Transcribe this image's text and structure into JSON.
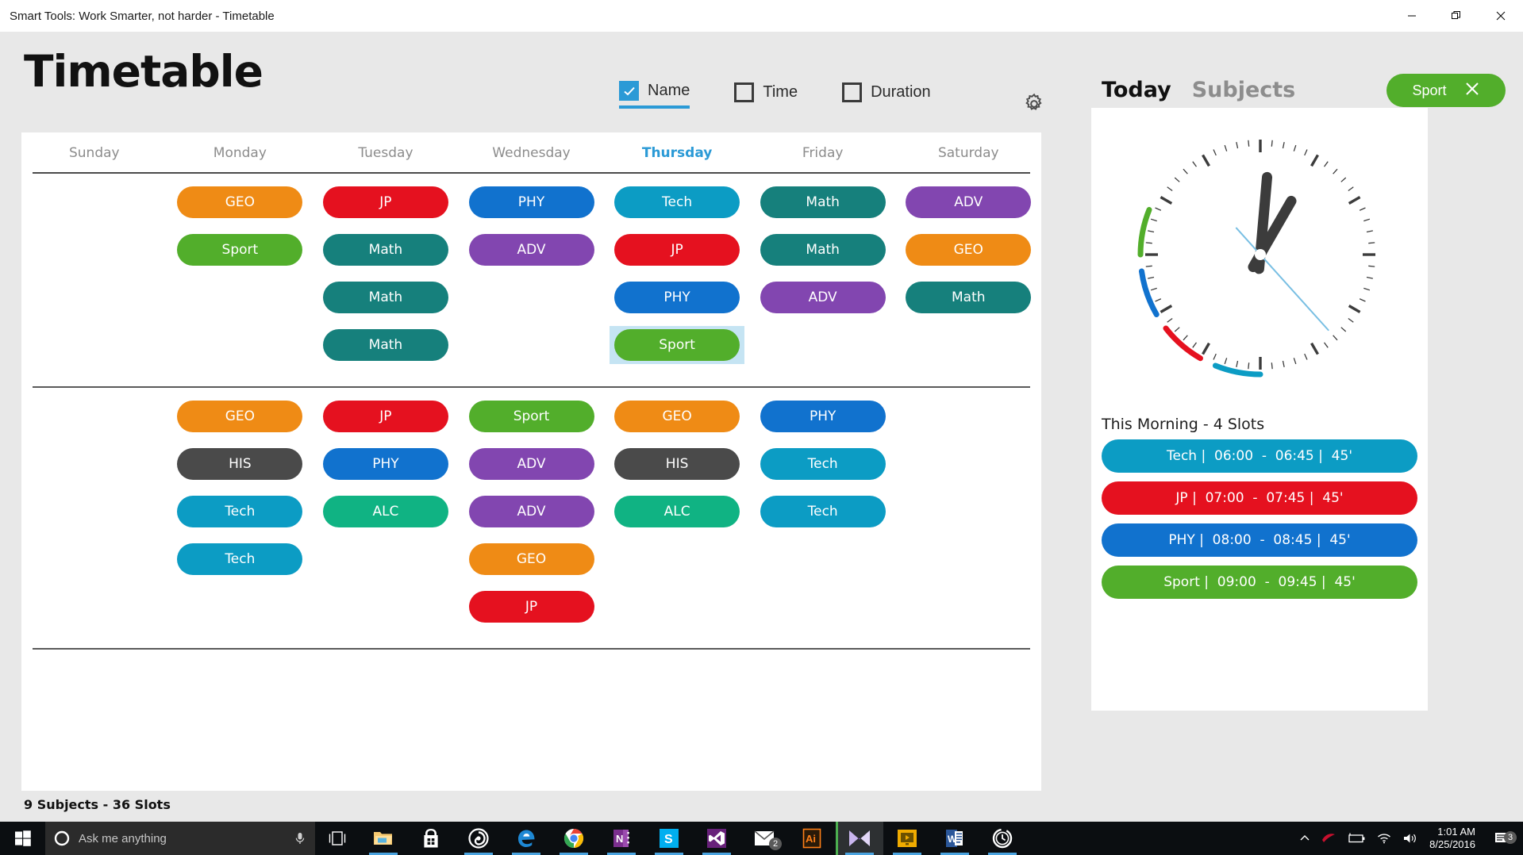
{
  "window": {
    "title": "Smart Tools: Work Smarter, not harder - Timetable",
    "minimize_label": "—",
    "maximize_label": "❐",
    "close_label": "✕"
  },
  "app": {
    "title": "Timetable",
    "footer": "9 Subjects  -  36 Slots",
    "gear_icon": "gear-icon"
  },
  "modes": [
    {
      "label": "Name",
      "checked": true
    },
    {
      "label": "Time",
      "checked": false
    },
    {
      "label": "Duration",
      "checked": false
    }
  ],
  "colors": {
    "GEO": "#ef8b15",
    "Sport": "#52ae2b",
    "JP": "#e5111f",
    "Math": "#16807c",
    "PHY": "#1172ce",
    "ADV": "#8246b0",
    "Tech": "#0c9cc4",
    "HIS": "#4a4a4a",
    "ALC": "#10b383",
    "accent": "#2b9ad6",
    "selection": "#c5e4f3"
  },
  "timetable": {
    "days": [
      {
        "name": "Sunday",
        "active": false
      },
      {
        "name": "Monday",
        "active": false
      },
      {
        "name": "Tuesday",
        "active": false
      },
      {
        "name": "Wednesday",
        "active": false
      },
      {
        "name": "Thursday",
        "active": true
      },
      {
        "name": "Friday",
        "active": false
      },
      {
        "name": "Saturday",
        "active": false
      }
    ],
    "blocks": [
      {
        "columns": [
          [],
          [
            {
              "label": "GEO"
            },
            {
              "label": "Sport"
            }
          ],
          [
            {
              "label": "JP"
            },
            {
              "label": "Math"
            },
            {
              "label": "Math"
            },
            {
              "label": "Math"
            }
          ],
          [
            {
              "label": "PHY"
            },
            {
              "label": "ADV"
            }
          ],
          [
            {
              "label": "Tech"
            },
            {
              "label": "JP"
            },
            {
              "label": "PHY"
            },
            {
              "label": "Sport",
              "selected": true
            }
          ],
          [
            {
              "label": "Math"
            },
            {
              "label": "Math"
            },
            {
              "label": "ADV"
            }
          ],
          [
            {
              "label": "ADV"
            },
            {
              "label": "GEO"
            },
            {
              "label": "Math"
            }
          ]
        ]
      },
      {
        "columns": [
          [],
          [
            {
              "label": "GEO"
            },
            {
              "label": "HIS"
            },
            {
              "label": "Tech"
            },
            {
              "label": "Tech"
            }
          ],
          [
            {
              "label": "JP"
            },
            {
              "label": "PHY"
            },
            {
              "label": "ALC"
            }
          ],
          [
            {
              "label": "Sport"
            },
            {
              "label": "ADV"
            },
            {
              "label": "ADV"
            },
            {
              "label": "GEO"
            },
            {
              "label": "JP"
            }
          ],
          [
            {
              "label": "GEO"
            },
            {
              "label": "HIS"
            },
            {
              "label": "ALC"
            }
          ],
          [
            {
              "label": "PHY"
            },
            {
              "label": "Tech"
            },
            {
              "label": "Tech"
            }
          ],
          []
        ]
      }
    ]
  },
  "sidebar": {
    "tabs": [
      {
        "label": "Today",
        "active": true
      },
      {
        "label": "Subjects",
        "active": false
      }
    ],
    "selected_subject": {
      "label": "Sport",
      "color": "#52ae2b",
      "close_icon": "close-icon"
    },
    "clock": {
      "hour_hand_deg": 5,
      "minute_hand_deg": 30,
      "second_hand_deg": 138,
      "arcs": [
        {
          "subject": "Tech",
          "color": "#0c9cc4",
          "start_deg": 180,
          "end_deg": 202
        },
        {
          "subject": "JP",
          "color": "#e5111f",
          "start_deg": 210,
          "end_deg": 232
        },
        {
          "subject": "PHY",
          "color": "#1172ce",
          "start_deg": 240,
          "end_deg": 262
        },
        {
          "subject": "Sport",
          "color": "#52ae2b",
          "start_deg": 270,
          "end_deg": 292
        }
      ]
    },
    "slots_heading": "This Morning - 4 Slots",
    "slots": [
      {
        "text": "Tech |  06:00  -  06:45 |  45'",
        "color": "#0c9cc4"
      },
      {
        "text": "JP |  07:00  -  07:45 |  45'",
        "color": "#e5111f"
      },
      {
        "text": "PHY |  08:00  -  08:45 |  45'",
        "color": "#1172ce"
      },
      {
        "text": "Sport |  09:00  -  09:45 |  45'",
        "color": "#52ae2b"
      }
    ]
  },
  "taskbar": {
    "start_icon": "windows-start-icon",
    "search_placeholder": "Ask me anything",
    "cortana_icon": "cortana-ring-icon",
    "mic_icon": "microphone-icon",
    "taskview_icon": "task-view-icon",
    "items": [
      {
        "name": "file-explorer-icon",
        "running": true,
        "active": false,
        "badge": ""
      },
      {
        "name": "microsoft-store-icon",
        "running": false,
        "active": false,
        "badge": ""
      },
      {
        "name": "groove-music-icon",
        "running": true,
        "active": false,
        "badge": ""
      },
      {
        "name": "microsoft-edge-icon",
        "running": true,
        "active": false,
        "badge": ""
      },
      {
        "name": "google-chrome-icon",
        "running": true,
        "active": false,
        "badge": ""
      },
      {
        "name": "onenote-icon",
        "running": true,
        "active": false,
        "badge": ""
      },
      {
        "name": "skype-icon",
        "running": true,
        "active": false,
        "badge": ""
      },
      {
        "name": "visual-studio-icon",
        "running": true,
        "active": false,
        "badge": ""
      },
      {
        "name": "mail-icon",
        "running": false,
        "active": false,
        "badge": "2"
      },
      {
        "name": "illustrator-icon",
        "running": false,
        "active": false,
        "badge": ""
      },
      {
        "name": "blend-icon",
        "running": true,
        "active": true,
        "badge": ""
      },
      {
        "name": "movie-maker-icon",
        "running": true,
        "active": false,
        "badge": ""
      },
      {
        "name": "word-icon",
        "running": true,
        "active": false,
        "badge": ""
      },
      {
        "name": "timetable-app-icon",
        "running": true,
        "active": false,
        "badge": ""
      }
    ],
    "tray": {
      "chevron_icon": "show-hidden-icons-chevron",
      "rog_icon": "rog-armoury-icon",
      "battery_icon": "battery-charging-icon",
      "wifi_icon": "wifi-icon",
      "volume_icon": "speaker-volume-icon",
      "time": "1:01 AM",
      "date": "8/25/2016",
      "action_center_icon": "action-center-icon",
      "action_center_badge": "3"
    }
  }
}
